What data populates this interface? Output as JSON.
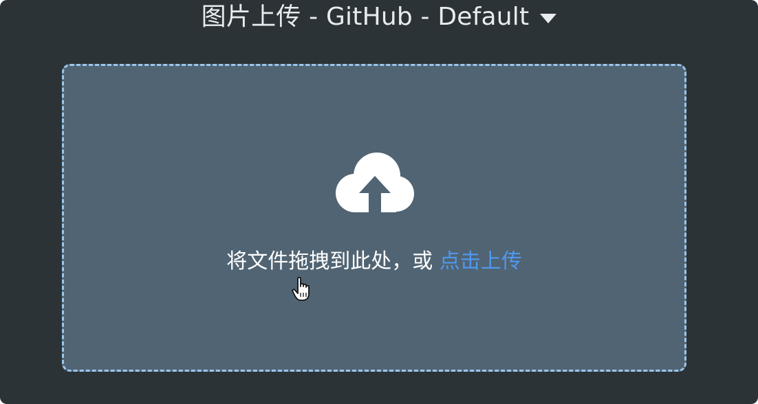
{
  "dialog": {
    "title": "图片上传 - GitHub - Default",
    "title_caret_icon": "triangle-down-icon"
  },
  "upload_area": {
    "icon": "cloud-upload-icon",
    "prompt_text": "将文件拖拽到此处，或",
    "click_upload_label": "点击上传"
  },
  "colors": {
    "window_background": "#2c3336",
    "drop_zone_background": "#516473",
    "drop_zone_border": "#9cc7ee",
    "link_color": "#4f98f0",
    "text_color": "#ffffff"
  }
}
